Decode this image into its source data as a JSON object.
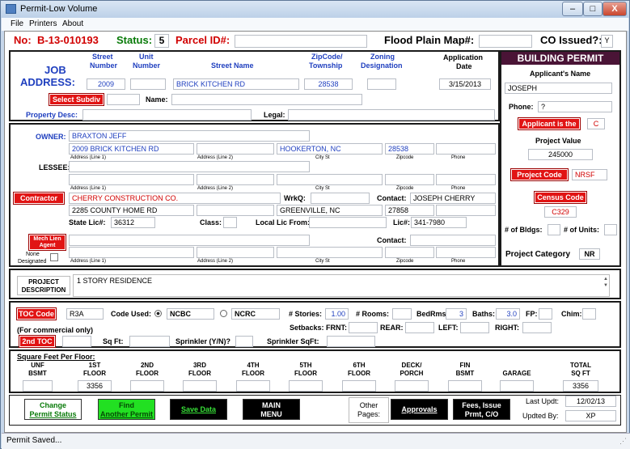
{
  "window": {
    "title": "Permit-Low Volume",
    "btn_min": "–",
    "btn_max": "□",
    "btn_close": "X"
  },
  "menu": [
    "File",
    "Printers",
    "About"
  ],
  "header": {
    "no_label": "No:",
    "no_value": "B-13-010193",
    "status_label": "Status:",
    "status_value": "5",
    "parcel_label": "Parcel ID#:",
    "parcel_value": "",
    "flood_label": "Flood Plain Map#:",
    "flood_value": "",
    "co_label": "CO Issued?:",
    "co_value": "Y"
  },
  "job": {
    "label1": "JOB",
    "label2": "ADDRESS:",
    "hdr_street_no_1": "Street",
    "hdr_street_no_2": "Number",
    "hdr_unit_1": "Unit",
    "hdr_unit_2": "Number",
    "hdr_street_name": "Street Name",
    "hdr_zip_1": "ZipCode/",
    "hdr_zip_2": "Township",
    "hdr_zoning_1": "Zoning",
    "hdr_zoning_2": "Designation",
    "hdr_app_1": "Application",
    "hdr_app_2": "Date",
    "street_no": "2009",
    "unit": "",
    "street_name": "BRICK KITCHEN RD",
    "zip": "28538",
    "zoning": "",
    "app_date": "3/15/2013",
    "select_subdiv": "Select Subdiv",
    "subdiv": "",
    "name_label": "Name:",
    "name_value": "",
    "property_desc_label": "Property Desc:",
    "property_desc": "",
    "legal_label": "Legal:",
    "legal": ""
  },
  "building_permit": {
    "title": "BUILDING PERMIT",
    "applicant_label": "Applicant's Name",
    "applicant": "JOSEPH",
    "phone_label": "Phone:",
    "phone": "?",
    "applicant_is_the": "Applicant is the",
    "applicant_is_value": "C",
    "project_value_label": "Project Value",
    "project_value": "245000",
    "project_code_btn": "Project Code",
    "project_code": "NRSF",
    "census_code_btn": "Census Code",
    "census_code": "C329",
    "bldgs_label": "# of Bldgs:",
    "bldgs": "",
    "units_label": "# of Units:",
    "units": "",
    "category_label": "Project Category",
    "category": "NR"
  },
  "owner": {
    "label": "OWNER:",
    "name": "BRAXTON JEFF",
    "addr1": "2009 BRICK KITCHEN RD",
    "addr2": "",
    "city": "HOOKERTON, NC",
    "zip": "28538",
    "phone": "",
    "sub_addr1": "Address (Line 1)",
    "sub_addr2": "Address (Line 2)",
    "sub_city": "City St",
    "sub_zip": "Zipcode",
    "sub_phone": "Phone"
  },
  "lessee": {
    "label": "LESSEE:",
    "addr1": "",
    "addr2": "",
    "city": "",
    "zip": "",
    "phone": ""
  },
  "contractor": {
    "btn": "Contractor",
    "name": "CHERRY CONSTRUCTION CO.",
    "wrkq_label": "WrkQ:",
    "wrkq": "",
    "contact_label": "Contact:",
    "contact": "JOSEPH CHERRY",
    "addr1": "2285 COUNTY HOME RD",
    "addr2": "",
    "city": "GREENVILLE, NC",
    "zip": "27858",
    "phone": "",
    "state_lic_label": "State Lic#:",
    "state_lic": "36312",
    "class_label": "Class:",
    "class": "",
    "local_lic_label": "Local Lic From:",
    "local_lic": "",
    "lic_label": "Lic#:",
    "lic": "341-7980"
  },
  "mech_lien": {
    "btn1": "Mech Lien",
    "btn2": "Agent",
    "name": "",
    "contact_label": "Contact:",
    "contact": "",
    "none_label1": "None",
    "none_label2": "Designated"
  },
  "project": {
    "label1": "PROJECT",
    "label2": "DESCRIPTION",
    "desc": "1 STORY RESIDENCE"
  },
  "toc": {
    "btn": "TOC Code",
    "code": "R3A",
    "code_used_label": "Code Used:",
    "ncbc": "NCBC",
    "ncrc": "NCRC",
    "stories_label": "# Stories:",
    "stories": "1.00",
    "rooms_label": "# Rooms:",
    "rooms": "",
    "bedrms_label": "BedRms:",
    "bedrms": "3",
    "baths_label": "Baths:",
    "baths": "3.0",
    "fp_label": "FP:",
    "fp": "",
    "chim_label": "Chim:",
    "chim": "",
    "commercial_note": "(For commercial only)",
    "setbacks_label": "Setbacks: FRNT:",
    "frnt": "",
    "rear_label": "REAR:",
    "rear": "",
    "left_label": "LEFT:",
    "left": "",
    "right_label": "RIGHT:",
    "right": "",
    "toc2_btn": "2nd TOC",
    "toc2": "",
    "sqft_label": "Sq Ft:",
    "sqft": "",
    "sprinkler_label": "Sprinkler (Y/N)?",
    "sprinkler": "",
    "sprinkler_sqft_label": "Sprinkler SqFt:",
    "sprinkler_sqft": ""
  },
  "floors": {
    "title": "Square Feet Per Floor:",
    "headers": [
      [
        "UNF",
        "BSMT"
      ],
      [
        "1ST",
        "FLOOR"
      ],
      [
        "2ND",
        "FLOOR"
      ],
      [
        "3RD",
        "FLOOR"
      ],
      [
        "4TH",
        "FLOOR"
      ],
      [
        "5TH",
        "FLOOR"
      ],
      [
        "6TH",
        "FLOOR"
      ],
      [
        "DECK/",
        "PORCH"
      ],
      [
        "FIN",
        "BSMT"
      ],
      [
        "",
        "GARAGE"
      ],
      [
        "TOTAL",
        "SQ FT"
      ]
    ],
    "values": [
      "",
      "3356",
      "",
      "",
      "",
      "",
      "",
      "",
      "",
      "",
      "3356"
    ]
  },
  "actions": {
    "change1": "Change",
    "change2": "Permit Status",
    "find1": "Find",
    "find2": "Another Permit",
    "save": "Save Data",
    "main1": "MAIN",
    "main2": "MENU",
    "other1": "Other",
    "other2": "Pages:",
    "approvals": "Approvals",
    "fees1": "Fees, Issue",
    "fees2": "Prmt, C/O",
    "last_updt_label": "Last Updt:",
    "last_updt": "12/02/13",
    "updt_by_label": "Updted By:",
    "updt_by": "XP"
  },
  "status_bar": "Permit Saved...",
  "colors": {
    "red": "#e11414",
    "maroon_header": "#4a1436",
    "blue_text": "#1f3fbf"
  }
}
